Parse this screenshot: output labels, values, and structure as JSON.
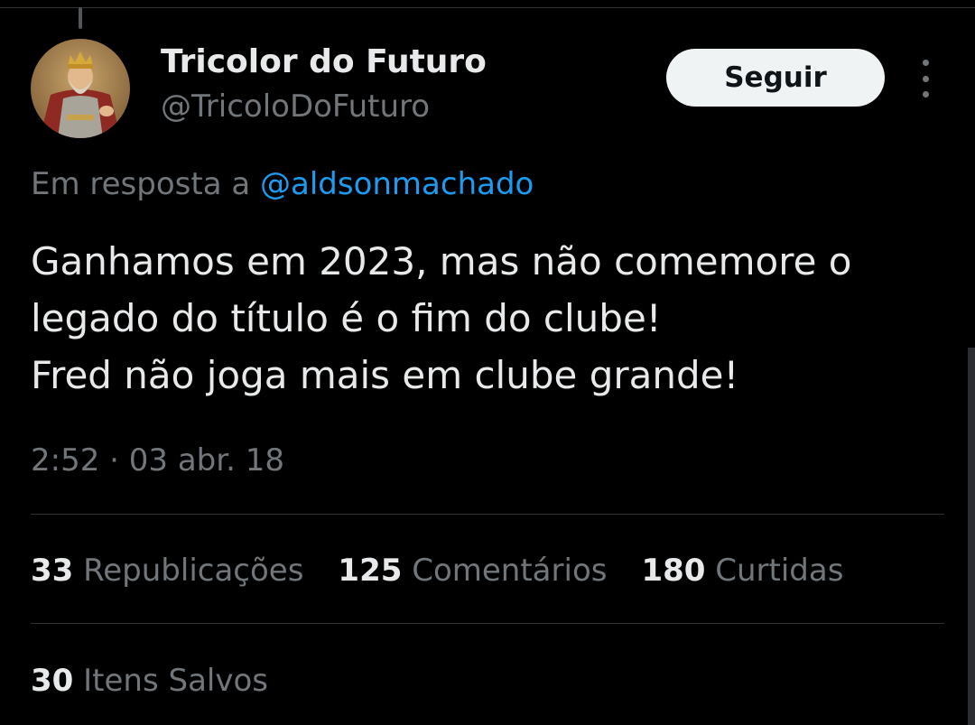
{
  "author": {
    "name": "Tricolor do Futuro",
    "handle": "@TricoloDoFuturo"
  },
  "follow_label": "Seguir",
  "reply": {
    "prefix": "Em resposta a ",
    "mention": "@aldsonmachado"
  },
  "tweet": {
    "lines": [
      "Ganhamos em 2023, mas não comemore o",
      "legado do título é o fim do clube!",
      "Fred não joga mais em clube grande!"
    ],
    "timestamp": "2:52 · 03 abr. 18"
  },
  "stats": [
    {
      "count": "33",
      "label": "Republicações"
    },
    {
      "count": "125",
      "label": "Comentários"
    },
    {
      "count": "180",
      "label": "Curtidas"
    }
  ],
  "saved": {
    "count": "30",
    "label": "Itens Salvos"
  },
  "colors": {
    "background": "#000000",
    "text": "#e7e9ea",
    "muted": "#71767b",
    "link": "#1d9bf0",
    "button": "#eff3f4"
  },
  "icons": {
    "more": "more-vertical-icon"
  }
}
